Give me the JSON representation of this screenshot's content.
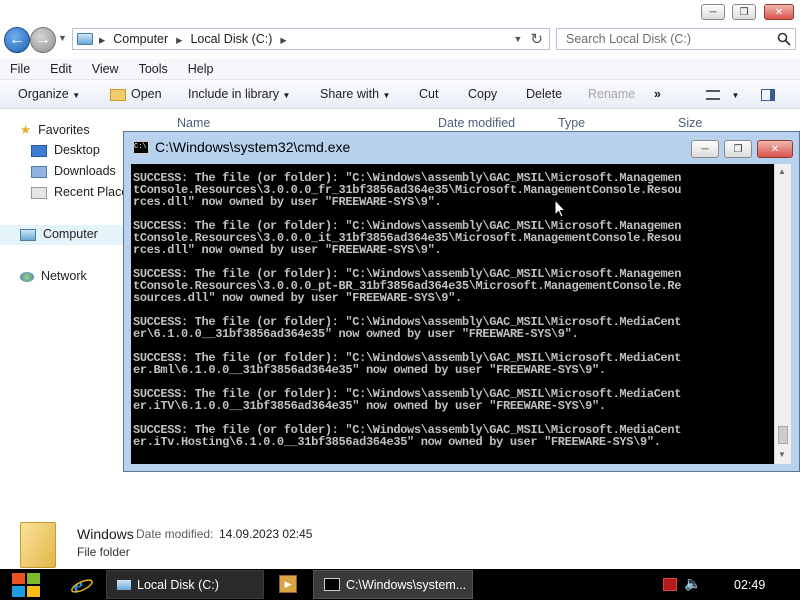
{
  "explorer": {
    "breadcrumb": [
      "Computer",
      "Local Disk (C:)"
    ],
    "search_placeholder": "Search Local Disk (C:)",
    "menu": [
      "File",
      "Edit",
      "View",
      "Tools",
      "Help"
    ],
    "toolbar": {
      "organize": "Organize",
      "open": "Open",
      "include": "Include in library",
      "share": "Share with",
      "cut": "Cut",
      "copy": "Copy",
      "delete": "Delete",
      "rename": "Rename",
      "more": "»"
    },
    "nav": {
      "favorites": "Favorites",
      "desktop": "Desktop",
      "downloads": "Downloads",
      "recent": "Recent Places",
      "computer": "Computer",
      "network": "Network"
    },
    "columns": [
      "Name",
      "Date modified",
      "Type",
      "Size"
    ],
    "details": {
      "name": "Windows",
      "date_label": "Date modified:",
      "date_value": "14.09.2023 02:45",
      "type": "File folder"
    }
  },
  "cmd": {
    "title": "C:\\Windows\\system32\\cmd.exe",
    "blocks": [
      [
        "SUCCESS: The file (or folder): \"C:\\Windows\\assembly\\GAC_MSIL\\Microsoft.Managemen",
        "tConsole.Resources\\3.0.0.0_fr_31bf3856ad364e35\\Microsoft.ManagementConsole.Resou",
        "rces.dll\" now owned by user \"FREEWARE-SYS\\9\"."
      ],
      [
        "SUCCESS: The file (or folder): \"C:\\Windows\\assembly\\GAC_MSIL\\Microsoft.Managemen",
        "tConsole.Resources\\3.0.0.0_it_31bf3856ad364e35\\Microsoft.ManagementConsole.Resou",
        "rces.dll\" now owned by user \"FREEWARE-SYS\\9\"."
      ],
      [
        "SUCCESS: The file (or folder): \"C:\\Windows\\assembly\\GAC_MSIL\\Microsoft.Managemen",
        "tConsole.Resources\\3.0.0.0_pt-BR_31bf3856ad364e35\\Microsoft.ManagementConsole.Re",
        "sources.dll\" now owned by user \"FREEWARE-SYS\\9\"."
      ],
      [
        "SUCCESS: The file (or folder): \"C:\\Windows\\assembly\\GAC_MSIL\\Microsoft.MediaCent",
        "er\\6.1.0.0__31bf3856ad364e35\" now owned by user \"FREEWARE-SYS\\9\"."
      ],
      [
        "SUCCESS: The file (or folder): \"C:\\Windows\\assembly\\GAC_MSIL\\Microsoft.MediaCent",
        "er.Bml\\6.1.0.0__31bf3856ad364e35\" now owned by user \"FREEWARE-SYS\\9\"."
      ],
      [
        "SUCCESS: The file (or folder): \"C:\\Windows\\assembly\\GAC_MSIL\\Microsoft.MediaCent",
        "er.iTV\\6.1.0.0__31bf3856ad364e35\" now owned by user \"FREEWARE-SYS\\9\"."
      ],
      [
        "SUCCESS: The file (or folder): \"C:\\Windows\\assembly\\GAC_MSIL\\Microsoft.MediaCent",
        "er.iTv.Hosting\\6.1.0.0__31bf3856ad364e35\" now owned by user \"FREEWARE-SYS\\9\"."
      ]
    ]
  },
  "taskbar": {
    "explorer_label": "Local Disk (C:)",
    "cmd_label": "C:\\Windows\\system...",
    "clock": "02:49"
  },
  "colors": {
    "cmd_background": "#000000",
    "cmd_text": "#c0c0c0",
    "window_frame": "#b8d1ec",
    "taskbar": "#000000",
    "selection": "#cde8ff"
  },
  "icons": [
    "back-arrow-icon",
    "forward-arrow-icon",
    "computer-icon",
    "refresh-icon",
    "search-icon",
    "folder-icon",
    "star-icon",
    "desktop-icon",
    "downloads-icon",
    "recent-places-icon",
    "network-icon",
    "cmd-icon",
    "windows-start-icon",
    "ie-icon",
    "media-player-icon",
    "speaker-icon",
    "action-center-icon"
  ]
}
